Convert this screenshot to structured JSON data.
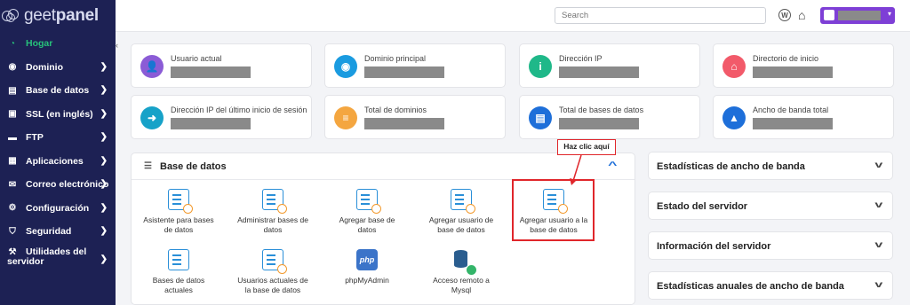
{
  "brand": {
    "name_light": "geet",
    "name_bold": "panel"
  },
  "sidebar": {
    "items": [
      {
        "label": "Hogar",
        "icon": "dashboard-icon",
        "active": true,
        "has_chevron": false
      },
      {
        "label": "Dominio",
        "icon": "globe-icon",
        "has_chevron": true
      },
      {
        "label": "Base de datos",
        "icon": "database-icon",
        "has_chevron": true
      },
      {
        "label": "SSL (en inglés)",
        "icon": "lock-icon",
        "has_chevron": true
      },
      {
        "label": "FTP",
        "icon": "folder-icon",
        "has_chevron": true
      },
      {
        "label": "Aplicaciones",
        "icon": "grid-icon",
        "has_chevron": true
      },
      {
        "label": "Correo electrónico",
        "icon": "envelope-icon",
        "has_chevron": true
      },
      {
        "label": "Configuración",
        "icon": "gears-icon",
        "has_chevron": true
      },
      {
        "label": "Seguridad",
        "icon": "shield-icon",
        "has_chevron": true
      },
      {
        "label_line1": "Utilidades del",
        "label_line2": "servidor",
        "icon": "wrench-icon",
        "has_chevron": true
      }
    ],
    "collapse_glyph": "‹"
  },
  "topbar": {
    "search_placeholder": "Search",
    "caret": "▾"
  },
  "cards": [
    {
      "label": "Usuario actual",
      "color": "#8b5cd6",
      "icon": "user-icon"
    },
    {
      "label": "Dominio principal",
      "color": "#1a9be0",
      "icon": "globe-icon"
    },
    {
      "label": "Dirección IP",
      "color": "#1fb889",
      "icon": "info-icon"
    },
    {
      "label": "Directorio de inicio",
      "color": "#f25a6a",
      "icon": "home-icon"
    },
    {
      "label": "Dirección IP del último inicio de sesión",
      "color": "#17a2c8",
      "icon": "sign-in-icon"
    },
    {
      "label": "Total de dominios",
      "color": "#f4a640",
      "icon": "list-icon"
    },
    {
      "label": "Total de bases de datos",
      "color": "#1e6fd9",
      "icon": "database-icon"
    },
    {
      "label": "Ancho de banda total",
      "color": "#1e6fd9",
      "icon": "chart-icon"
    }
  ],
  "database_panel": {
    "title": "Base de datos",
    "tools": [
      {
        "line1": "Asistente para bases",
        "line2": "de datos",
        "icon": "database-wizard-icon"
      },
      {
        "line1": "Administrar bases de",
        "line2": "datos",
        "icon": "database-manage-icon"
      },
      {
        "line1": "Agregar base de",
        "line2": "datos",
        "icon": "database-add-icon"
      },
      {
        "line1": "Agregar usuario de",
        "line2": "base de datos",
        "icon": "database-user-add-icon"
      },
      {
        "line1": "Agregar usuario a la",
        "line2": "base de datos",
        "icon": "database-user-assign-icon"
      },
      {
        "line1": "Bases de datos",
        "line2": "actuales",
        "icon": "database-list-icon"
      },
      {
        "line1": "Usuarios actuales de",
        "line2": "la base de datos",
        "icon": "database-users-icon"
      },
      {
        "line1": "phpMyAdmin",
        "line2": "",
        "icon": "phpmyadmin-icon",
        "icon_text": "php"
      },
      {
        "line1": "Acceso remoto a",
        "line2": "Mysql",
        "icon": "mysql-remote-icon"
      }
    ]
  },
  "annotation": {
    "callout": "Haz clic aquí"
  },
  "accordions": [
    {
      "label": "Estadísticas de ancho de banda"
    },
    {
      "label": "Estado del servidor"
    },
    {
      "label": "Información del servidor"
    },
    {
      "label": "Estadísticas anuales de ancho de banda"
    }
  ]
}
